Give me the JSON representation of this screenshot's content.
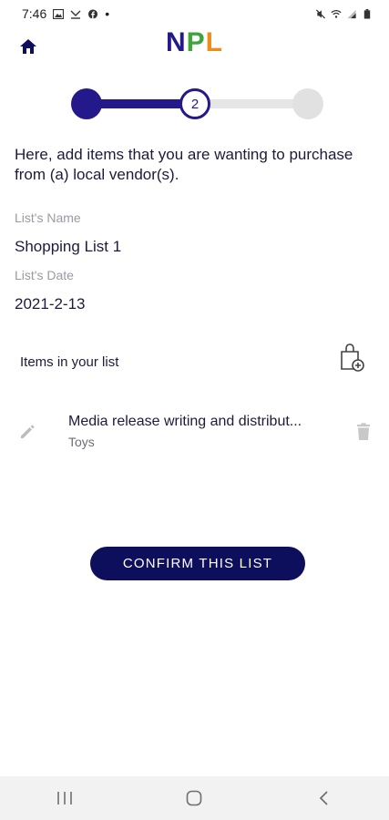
{
  "status_bar": {
    "time": "7:46",
    "dot": "•",
    "left_icons": [
      "image-icon",
      "missed-call-icon",
      "facebook-icon"
    ],
    "right_icons": [
      "mute-icon",
      "wifi-icon",
      "signal-icon",
      "battery-icon"
    ]
  },
  "header": {
    "logo_n": "N",
    "logo_p": "P",
    "logo_l": "L",
    "home_icon": "home-icon",
    "colors": {
      "n": "#23198a",
      "p": "#3ca63a",
      "l": "#f28a1a"
    }
  },
  "stepper": {
    "current_step": 2,
    "current_label": "2",
    "total_steps": 3,
    "active_color": "#23198a",
    "inactive_color": "#e6e6e6"
  },
  "intro_text": "Here, add items that you are wanting to purchase from (a) local vendor(s).",
  "list_name": {
    "label": "List's Name",
    "value": "Shopping List 1"
  },
  "list_date": {
    "label": "List's Date",
    "value": "2021-2-13"
  },
  "items_section": {
    "title": "Items in your list",
    "add_icon": "add-shopping-bag-icon",
    "items": [
      {
        "name": "Media release writing and distribut...",
        "category": "Toys"
      }
    ]
  },
  "confirm_button": {
    "label": "CONFIRM THIS LIST",
    "color": "#0e0f5c"
  },
  "nav_bar": {
    "icons": [
      "recent-apps-icon",
      "home-circle-icon",
      "back-icon"
    ]
  }
}
